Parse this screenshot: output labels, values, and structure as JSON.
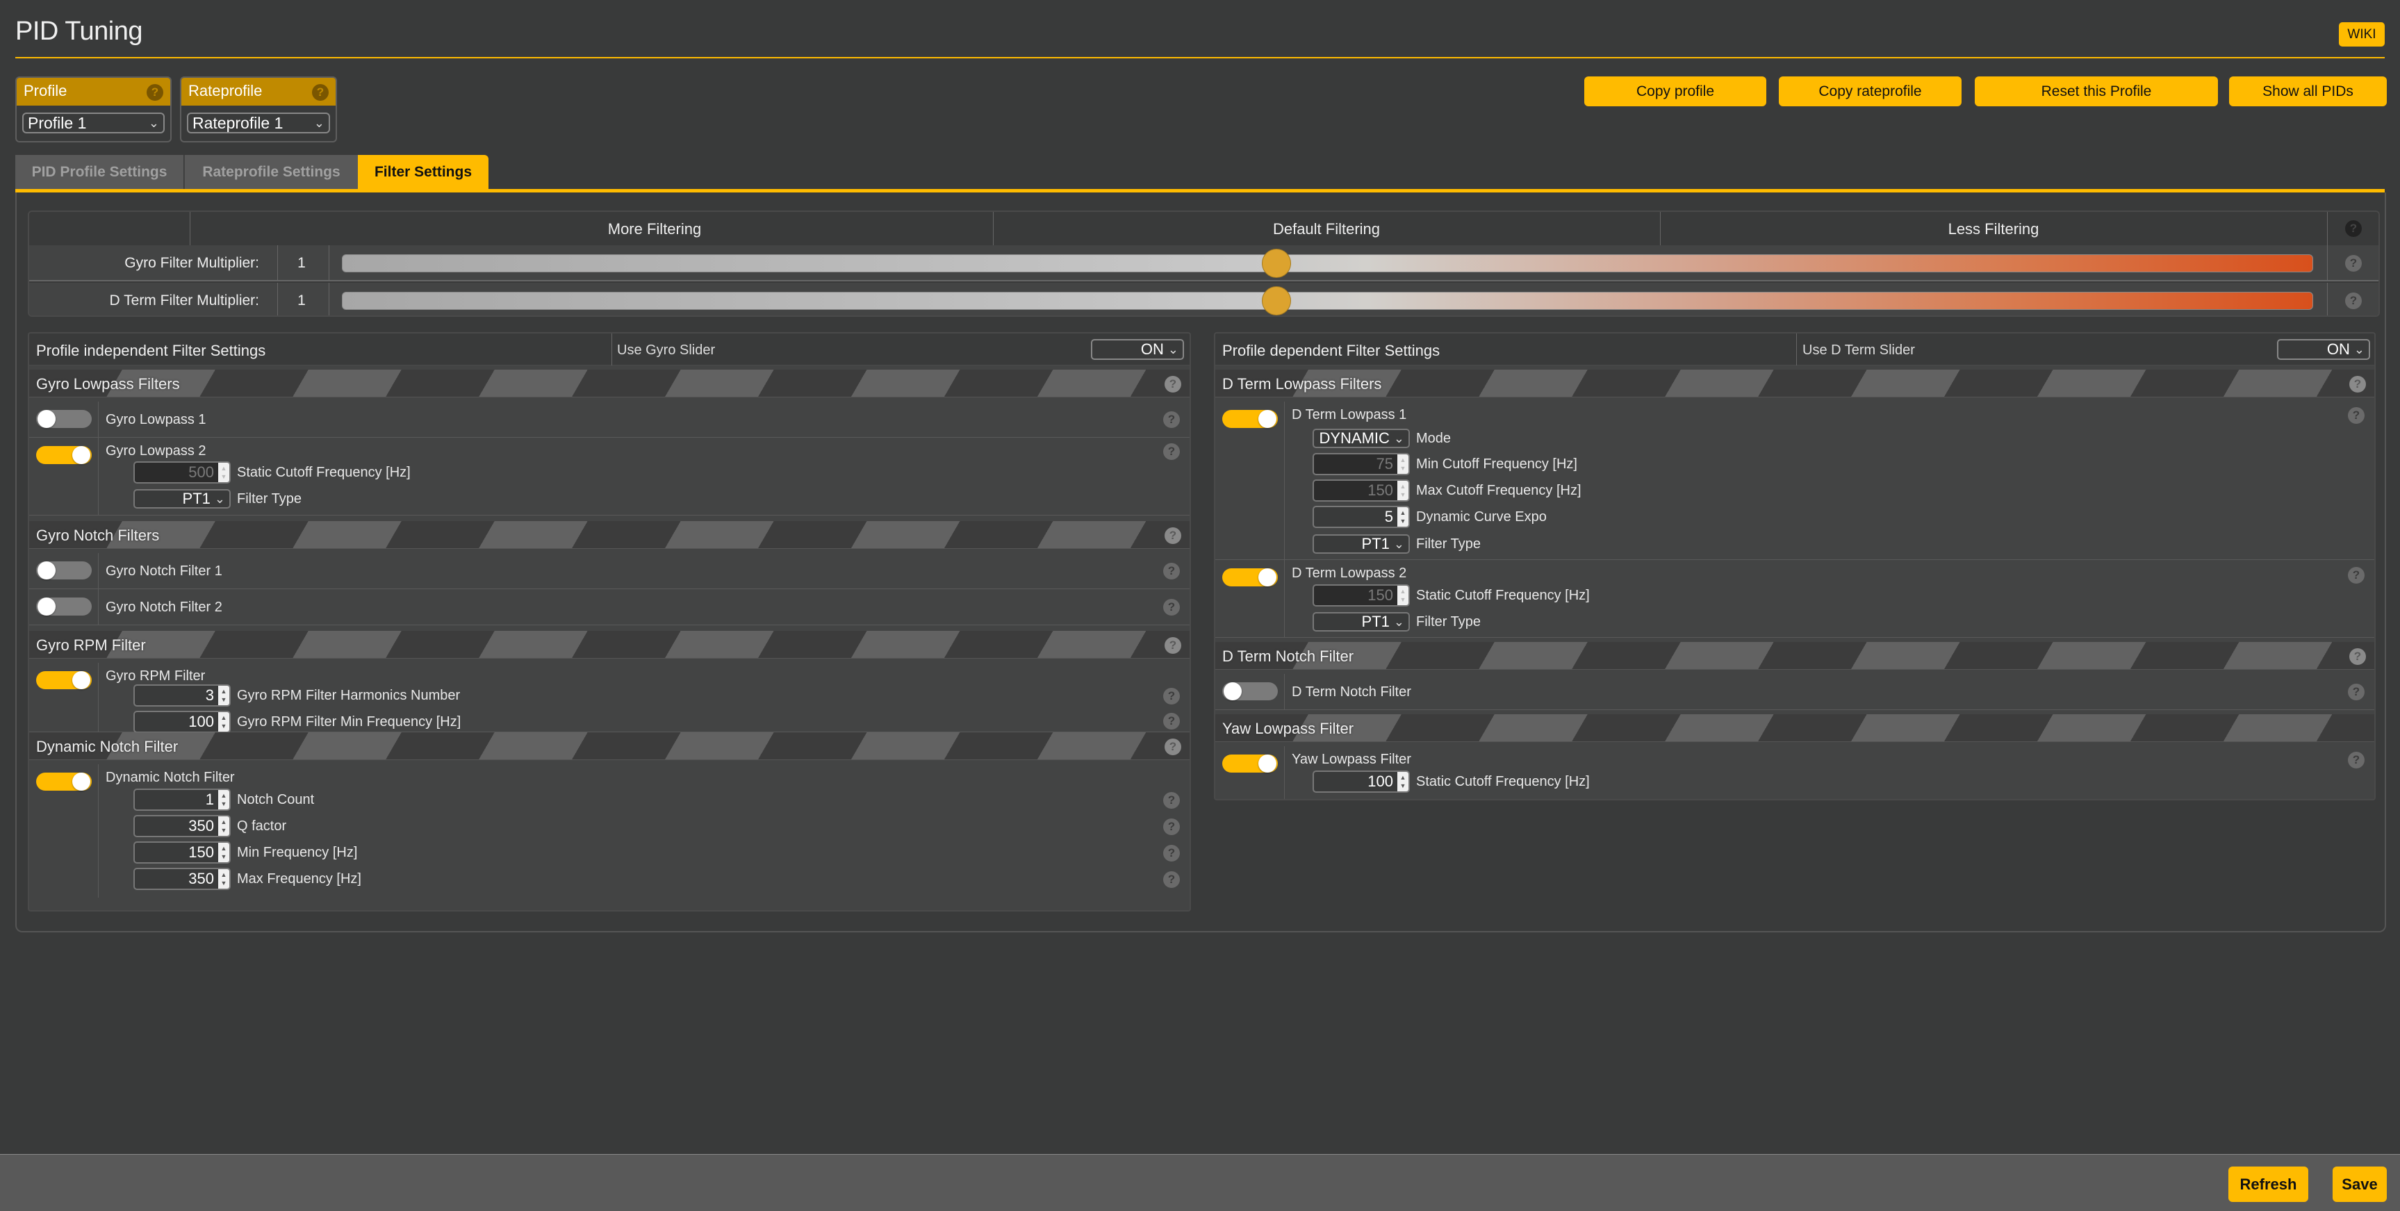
{
  "header": {
    "title": "PID Tuning",
    "wiki_label": "WIKI"
  },
  "profile": {
    "label": "Profile",
    "selected": "Profile 1"
  },
  "rateprofile": {
    "label": "Rateprofile",
    "selected": "Rateprofile 1"
  },
  "actions": {
    "copy_profile": "Copy profile",
    "copy_rateprofile": "Copy rateprofile",
    "reset_profile": "Reset this Profile",
    "show_all_pids": "Show all PIDs"
  },
  "tabs": [
    {
      "label": "PID Profile Settings",
      "active": false
    },
    {
      "label": "Rateprofile Settings",
      "active": false
    },
    {
      "label": "Filter Settings",
      "active": true
    }
  ],
  "sliders": {
    "headers": [
      "More Filtering",
      "Default Filtering",
      "Less Filtering"
    ],
    "rows": [
      {
        "label": "Gyro Filter Multiplier:",
        "value": "1",
        "position_fraction": 0.474
      },
      {
        "label": "D Term Filter Multiplier:",
        "value": "1",
        "position_fraction": 0.474
      }
    ]
  },
  "left_panel": {
    "title": "Profile independent Filter Settings",
    "slider_label": "Use Gyro Slider",
    "slider_value": "ON",
    "sections": {
      "gyro_lowpass": {
        "title": "Gyro Lowpass Filters",
        "lowpass1": {
          "label": "Gyro Lowpass 1",
          "enabled": false
        },
        "lowpass2": {
          "label": "Gyro Lowpass 2",
          "enabled": true,
          "cutoff_value": "500",
          "cutoff_label": "Static Cutoff Frequency [Hz]",
          "type_value": "PT1",
          "type_label": "Filter Type"
        }
      },
      "gyro_notch": {
        "title": "Gyro Notch Filters",
        "notch1": {
          "label": "Gyro Notch Filter 1",
          "enabled": false
        },
        "notch2": {
          "label": "Gyro Notch Filter 2",
          "enabled": false
        }
      },
      "gyro_rpm": {
        "title": "Gyro RPM Filter",
        "filter": {
          "label": "Gyro RPM Filter",
          "enabled": true,
          "harmonics_value": "3",
          "harmonics_label": "Gyro RPM Filter Harmonics Number",
          "minfreq_value": "100",
          "minfreq_label": "Gyro RPM Filter Min Frequency [Hz]"
        }
      },
      "dyn_notch": {
        "title": "Dynamic Notch Filter",
        "filter": {
          "label": "Dynamic Notch Filter",
          "enabled": true,
          "count_value": "1",
          "count_label": "Notch Count",
          "q_value": "350",
          "q_label": "Q factor",
          "min_value": "150",
          "min_label": "Min Frequency [Hz]",
          "max_value": "350",
          "max_label": "Max Frequency [Hz]"
        }
      }
    }
  },
  "right_panel": {
    "title": "Profile dependent Filter Settings",
    "slider_label": "Use D Term Slider",
    "slider_value": "ON",
    "sections": {
      "dterm_lowpass": {
        "title": "D Term Lowpass Filters",
        "lowpass1": {
          "label": "D Term Lowpass 1",
          "enabled": true,
          "mode_value": "DYNAMIC",
          "mode_label": "Mode",
          "min_value": "75",
          "min_label": "Min Cutoff Frequency [Hz]",
          "max_value": "150",
          "max_label": "Max Cutoff Frequency [Hz]",
          "expo_value": "5",
          "expo_label": "Dynamic Curve Expo",
          "type_value": "PT1",
          "type_label": "Filter Type"
        },
        "lowpass2": {
          "label": "D Term Lowpass 2",
          "enabled": true,
          "cutoff_value": "150",
          "cutoff_label": "Static Cutoff Frequency [Hz]",
          "type_value": "PT1",
          "type_label": "Filter Type"
        }
      },
      "dterm_notch": {
        "title": "D Term Notch Filter",
        "notch": {
          "label": "D Term Notch Filter",
          "enabled": false
        }
      },
      "yaw_lowpass": {
        "title": "Yaw Lowpass Filter",
        "filter": {
          "label": "Yaw Lowpass Filter",
          "enabled": true,
          "cutoff_value": "100",
          "cutoff_label": "Static Cutoff Frequency [Hz]"
        }
      }
    }
  },
  "footer": {
    "refresh_label": "Refresh",
    "save_label": "Save"
  },
  "icons": {
    "help": "?",
    "chevron": "⌄",
    "spin_up": "▲",
    "spin_down": "▼"
  },
  "colors": {
    "accent": "#ffbb00",
    "background": "#393a3a",
    "panel": "#434444",
    "slider_end": "#d8501c"
  }
}
